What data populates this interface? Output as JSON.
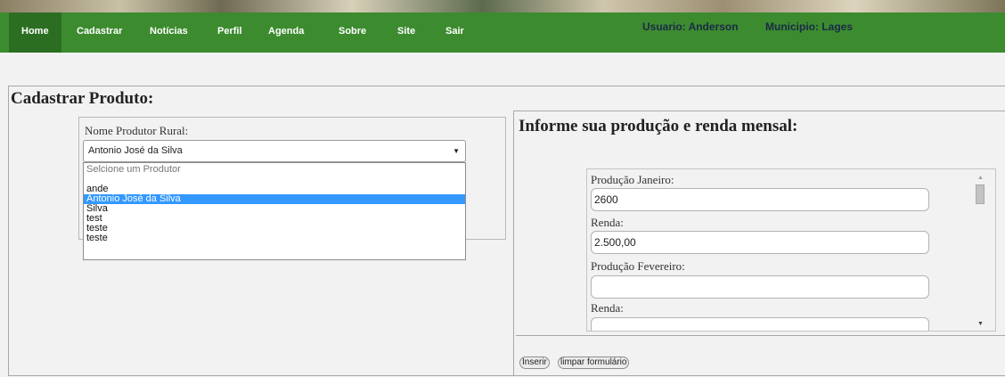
{
  "nav": {
    "items": [
      "Home",
      "Cadastrar",
      "Notícias",
      "Perfil",
      "Agenda",
      "Sobre",
      "Site",
      "Sair"
    ],
    "active": "Home"
  },
  "user": {
    "usuario": "Usuario: Anderson",
    "municipio": "Municipio: Lages"
  },
  "page": {
    "title": "Cadastrar Produto:"
  },
  "produtor": {
    "label": "Nome Produtor Rural:",
    "selected_value": "Antonio José da Silva",
    "options": [
      "Selcione um Produtor",
      "",
      "ande",
      "Antonio José da Silva",
      "Silva",
      "test",
      "teste",
      "teste"
    ]
  },
  "producao": {
    "title": "Informe sua produção e renda mensal:",
    "fields": [
      {
        "label": "Produção Janeiro:",
        "value": "2600"
      },
      {
        "label": "Renda:",
        "value": "2.500,00"
      },
      {
        "label": "Produção Fevereiro:",
        "value": ""
      },
      {
        "label": "Renda:",
        "value": ""
      }
    ]
  },
  "buttons": {
    "inserir": "Inserir",
    "limpar": "limpar formulário"
  },
  "colors": {
    "nav_bg": "#3c8b2f",
    "nav_active": "#2b6e22",
    "selected_option": "#3399ff"
  }
}
